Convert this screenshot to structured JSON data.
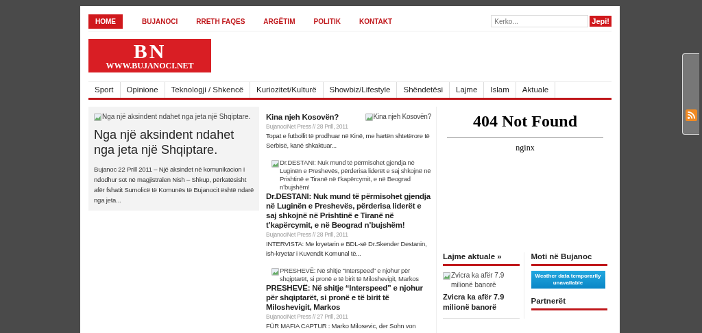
{
  "top_nav": [
    {
      "label": "HOME",
      "selected": true
    },
    {
      "label": "BUJANOCI",
      "selected": false
    },
    {
      "label": "RRETH FAQES",
      "selected": false
    },
    {
      "label": "ARGËTIM",
      "selected": false
    },
    {
      "label": "POLITIK",
      "selected": false
    },
    {
      "label": "KONTAKT",
      "selected": false
    }
  ],
  "search": {
    "placeholder": "Kerko...",
    "button": "Jepi!"
  },
  "logo": {
    "initials": "BN",
    "url": "WWW.BUJANOCI.NET"
  },
  "categories": [
    "Sport",
    "Opinione",
    "Teknologji / Shkencë",
    "Kuriozitet/Kulturë",
    "Showbiz/Lifestyle",
    "Shëndetësi",
    "Lajme",
    "Islam",
    "Aktuale"
  ],
  "featured": {
    "image_alt": "Nga një aksindent ndahet nga jeta një Shqiptare.",
    "title": "Nga një aksindent ndahet nga jeta një Shqiptare.",
    "excerpt": "Bujanoc 22 Prill 2011 – Një aksindet në komunikacion i ndodhur sot në magjistralen Nish – Shkup, përkatësisht afër fshatit Sumolicë të Komunës të Bujanocit është ndarë nga jeta..."
  },
  "articles": [
    {
      "kind": "side_image",
      "title": "Kina njeh Kosovën?",
      "image_alt": "Kina njeh Kosovën?",
      "meta": "BujanociNet Press // 28 Prill, 2011",
      "excerpt": "Topat e futbollit të prodhuar në Kinë, me hartën shtetërore të Serbisë, kanë shkaktuar..."
    },
    {
      "kind": "top_image",
      "title": "Dr.DESTANI: Nuk mund të përmisohet gjendja në Luginën e Preshevës, përderisa liderët e saj shkojnë në Prishtinë e Tiranë në t’kapërcymit, e në Beograd n’bujshëm!",
      "image_alt": "Dr.DESTANI: Nuk mund të përmisohet gjendja në Luginën e Preshevës, përderisa liderët e saj shkojnë në Prishtinë e Tiranë në t’kapërcymit, e në Beograd n’bujshëm!",
      "meta": "BujanociNet Press // 28 Prill, 2011",
      "excerpt": "INTERVISTA: Me kryetarin e BDL-së Dr.Skender Destanin, ish-kryetar i Kuvendit Komunal të..."
    },
    {
      "kind": "top_image",
      "title": "PRESHEVË: Në shitje “Interspeed” e njohur për shqiptarët, si pronë e të birit të Miloshevigit, Markos",
      "image_alt": "PRESHEVË: Në shitje “Interspeed” e njohur për shqiptarët, si pronë e të birit të Miloshevigit, Markos",
      "meta": "BujanociNet Press // 27 Prill, 2011",
      "excerpt": "FÜR MAFIA CAPTUR : Marko Milosevic, der Sohn von"
    }
  ],
  "embed": {
    "title": "404 Not Found",
    "server": "nginx"
  },
  "widgets": {
    "news": {
      "title": "Lajme aktuale »",
      "image_alt": "Zvicra ka afër 7.9 milionë banorë",
      "item_title": "Zvicra ka afër 7.9 milionë banorë"
    },
    "weather": {
      "title": "Moti në Bujanoc",
      "message": "Weather data temporarily unavailable"
    },
    "partners": {
      "title": "Partnerët"
    }
  }
}
